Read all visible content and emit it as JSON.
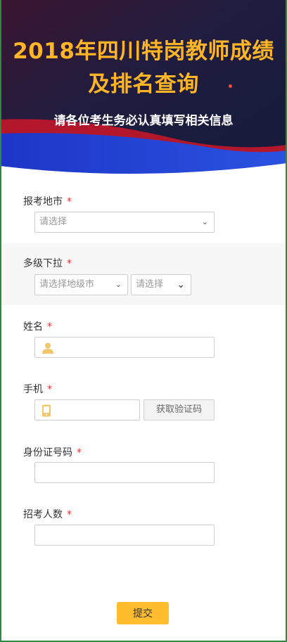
{
  "header": {
    "title": "2018年四川特岗教师成绩及排名查询",
    "subtitle": "请各位考生务必认真填写相关信息"
  },
  "form": {
    "required_mark": "*",
    "city": {
      "label": "报考地市",
      "placeholder": "请选择"
    },
    "multi_level": {
      "label": "多级下拉",
      "select1_placeholder": "请选择地级市",
      "select2_placeholder": "请选择"
    },
    "name": {
      "label": "姓名",
      "value": "",
      "icon": "user-icon"
    },
    "phone": {
      "label": "手机",
      "value": "",
      "icon": "mobile-phone-icon",
      "code_button": "获取验证码"
    },
    "id_number": {
      "label": "身份证号码",
      "value": ""
    },
    "recruit_count": {
      "label": "招考人数",
      "value": ""
    },
    "submit_label": "提交"
  },
  "colors": {
    "accent": "#ffbd2e",
    "title": "#ffb526",
    "required": "#e33333",
    "banner_blue": "#1f3fd0"
  }
}
